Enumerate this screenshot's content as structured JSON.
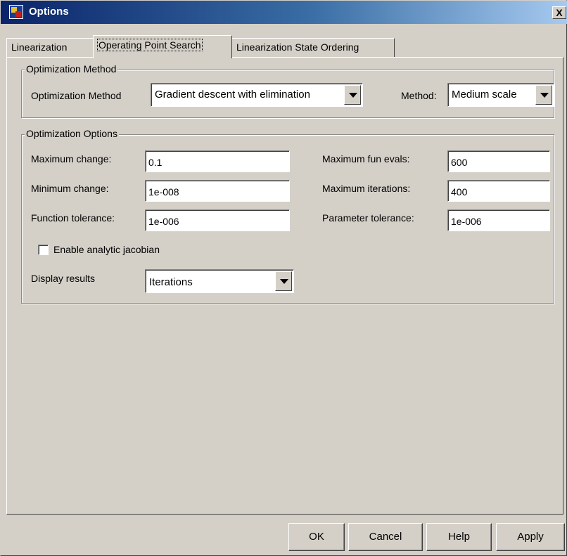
{
  "window": {
    "title": "Options",
    "close_label": "X"
  },
  "tabs": [
    {
      "label": "Linearization",
      "active": false
    },
    {
      "label": "Operating Point Search",
      "active": true
    },
    {
      "label": "Linearization State Ordering",
      "active": false
    }
  ],
  "method_group": {
    "title": "Optimization Method",
    "optimization_method_label": "Optimization Method",
    "optimization_method_value": "Gradient descent with elimination",
    "method_label": "Method:",
    "method_value": "Medium scale"
  },
  "options_group": {
    "title": "Optimization Options",
    "max_change_label": "Maximum change:",
    "max_change_value": "0.1",
    "min_change_label": "Minimum change:",
    "min_change_value": "1e-008",
    "function_tolerance_label": "Function tolerance:",
    "function_tolerance_value": "1e-006",
    "max_fun_evals_label": "Maximum fun evals:",
    "max_fun_evals_value": "600",
    "max_iterations_label": "Maximum iterations:",
    "max_iterations_value": "400",
    "parameter_tolerance_label": "Parameter tolerance:",
    "parameter_tolerance_value": "1e-006",
    "analytic_jacobian_label": "Enable analytic jacobian",
    "analytic_jacobian_checked": false,
    "display_results_label": "Display results",
    "display_results_value": "Iterations"
  },
  "buttons": {
    "ok": "OK",
    "cancel": "Cancel",
    "help": "Help",
    "apply": "Apply"
  },
  "colors": {
    "dialog_background": "#d4d0c8",
    "title_bar_start": "#0a246a",
    "title_bar_end": "#a6caf0"
  }
}
